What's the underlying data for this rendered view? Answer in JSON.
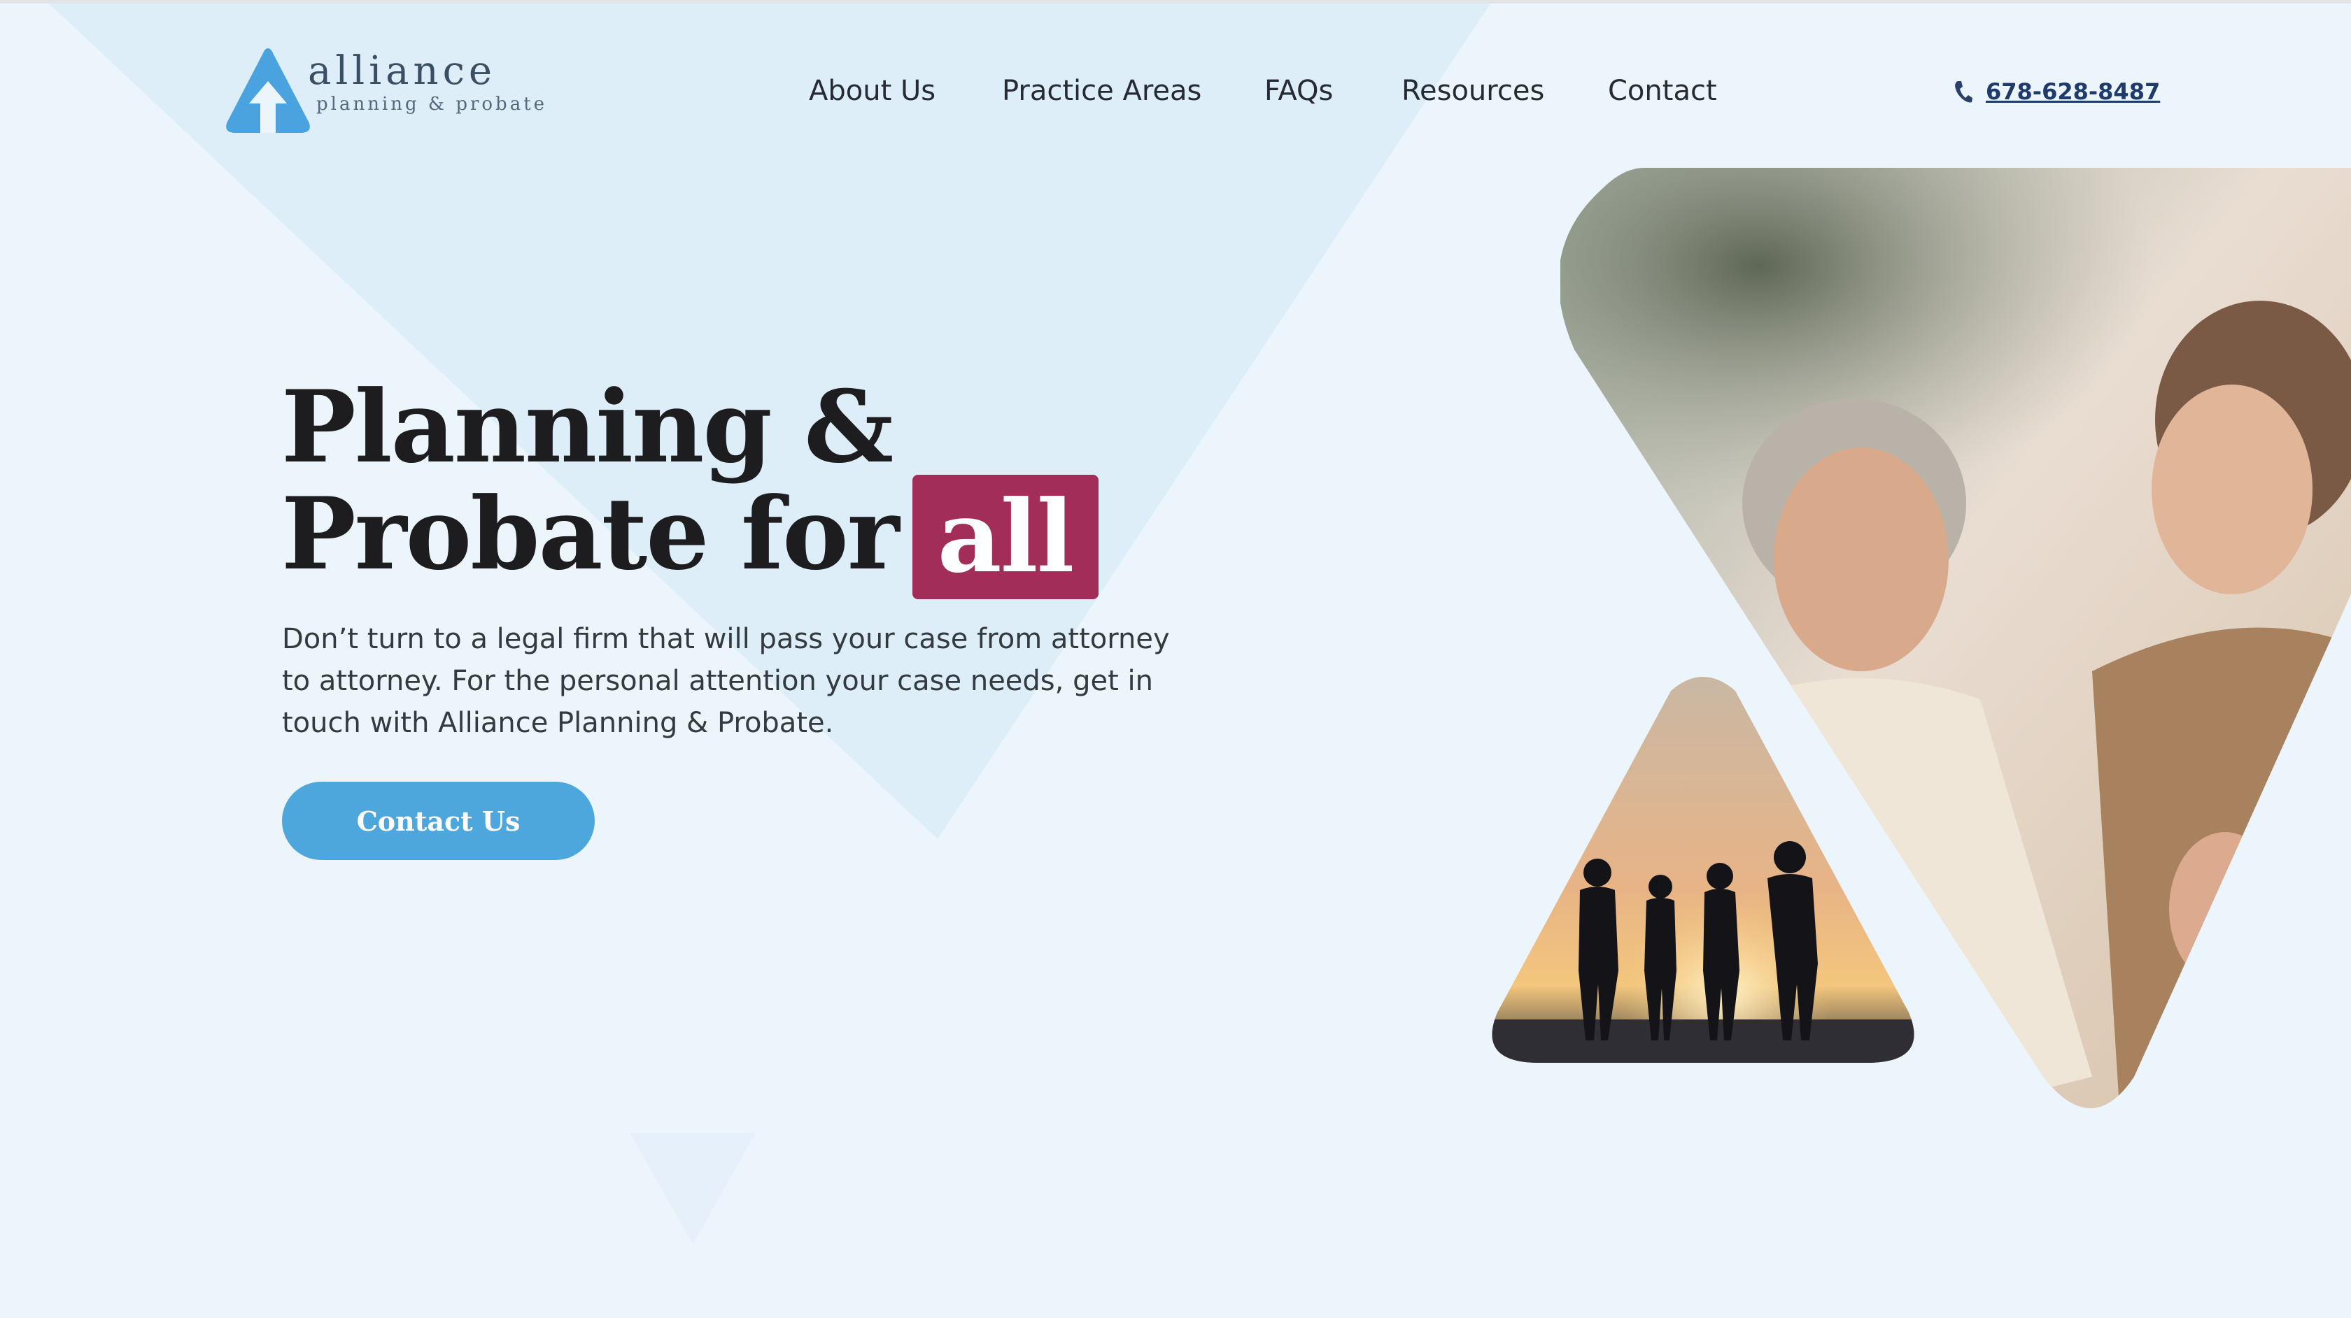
{
  "brand": {
    "name": "alliance",
    "tagline": "planning & probate"
  },
  "nav": {
    "items": [
      {
        "label": "About Us"
      },
      {
        "label": "Practice Areas"
      },
      {
        "label": "FAQs"
      },
      {
        "label": "Resources"
      },
      {
        "label": "Contact"
      }
    ]
  },
  "header": {
    "phone": "678-628-8487"
  },
  "hero": {
    "title_line1": "Planning &",
    "title_line2": "Probate for",
    "highlight": "all",
    "description": "Don’t turn to a legal firm that will pass your case from attorney to attorney. For the personal attention your case needs, get in touch with Alliance Planning & Probate.",
    "cta_label": "Contact Us"
  },
  "colors": {
    "accent_blue": "#4ea7dc",
    "highlight_magenta": "#a12d58",
    "background": "#ecf5fc",
    "logo_blue": "#4aa3df"
  }
}
